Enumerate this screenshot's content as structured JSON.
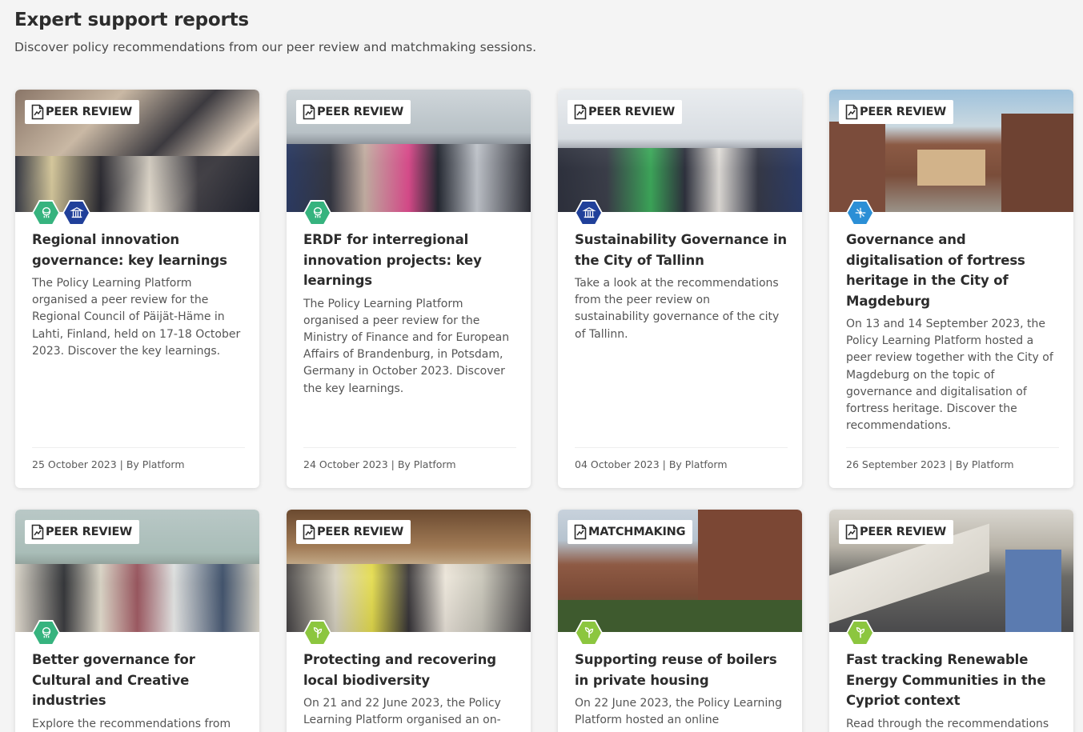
{
  "header": {
    "title": "Expert support reports",
    "subtitle": "Discover policy recommendations from our peer review and matchmaking sessions."
  },
  "colors": {
    "green": "#36b37e",
    "green_light": "#8cc63f",
    "navy": "#20409a",
    "blue": "#2b8fd6"
  },
  "cards": [
    {
      "tag": "PEER REVIEW",
      "tag_icon": "document-icon",
      "title": "Regional innovation governance: key learnings",
      "description": "The Policy Learning Platform organised a peer review for the Regional Council of Päijät-Häme in Lahti, Finland, held on 17-18 October 2023. Discover the key learnings.",
      "footer": "25 October 2023 | By Platform",
      "badges": [
        "green-governance-icon",
        "navy-institution-icon"
      ]
    },
    {
      "tag": "PEER REVIEW",
      "tag_icon": "document-icon",
      "title": "ERDF for interregional innovation projects: key learnings",
      "description": "The Policy Learning Platform organised a peer review for the Ministry of Finance and for European Affairs of Brandenburg, in Potsdam, Germany in October 2023. Discover the key learnings.",
      "footer": "24 October 2023 | By Platform",
      "badges": [
        "green-governance-icon"
      ]
    },
    {
      "tag": "PEER REVIEW",
      "tag_icon": "document-icon",
      "title": "Sustainability Governance in the City of Tallinn",
      "description": "Take a look at the recommendations from the peer review on sustainability governance of the city of Tallinn.",
      "footer": "04 October 2023 | By Platform",
      "badges": [
        "navy-institution-icon"
      ]
    },
    {
      "tag": "PEER REVIEW",
      "tag_icon": "document-icon",
      "title": "Governance and digitalisation of fortress heritage in the City of Magdeburg",
      "description": "On 13 and 14 September 2023, the Policy Learning Platform hosted a peer review together with the City of Magdeburg on the topic of governance and digitalisation of fortress heritage. Discover the recommendations.",
      "footer": "26 September 2023 | By Platform",
      "badges": [
        "blue-digital-icon"
      ]
    },
    {
      "tag": "PEER REVIEW",
      "tag_icon": "document-icon",
      "title": "Better governance for Cultural and Creative industries",
      "description": "Explore the recommendations from",
      "footer": "",
      "badges": [
        "green-governance-icon"
      ]
    },
    {
      "tag": "PEER REVIEW",
      "tag_icon": "document-icon",
      "title": "Protecting and recovering local biodiversity",
      "description": "On 21 and 22 June 2023, the Policy Learning Platform organised an on-",
      "footer": "",
      "badges": [
        "lightgreen-environment-icon"
      ]
    },
    {
      "tag": "MATCHMAKING",
      "tag_icon": "document-icon",
      "title": "Supporting reuse of boilers in private housing",
      "description": "On 22 June 2023, the Policy Learning Platform hosted an online",
      "footer": "",
      "badges": [
        "lightgreen-environment-icon"
      ]
    },
    {
      "tag": "PEER REVIEW",
      "tag_icon": "document-icon",
      "title": "Fast tracking Renewable Energy Communities in the Cypriot context",
      "description": "Read through the recommendations",
      "footer": "",
      "badges": [
        "lightgreen-environment-icon"
      ]
    }
  ]
}
